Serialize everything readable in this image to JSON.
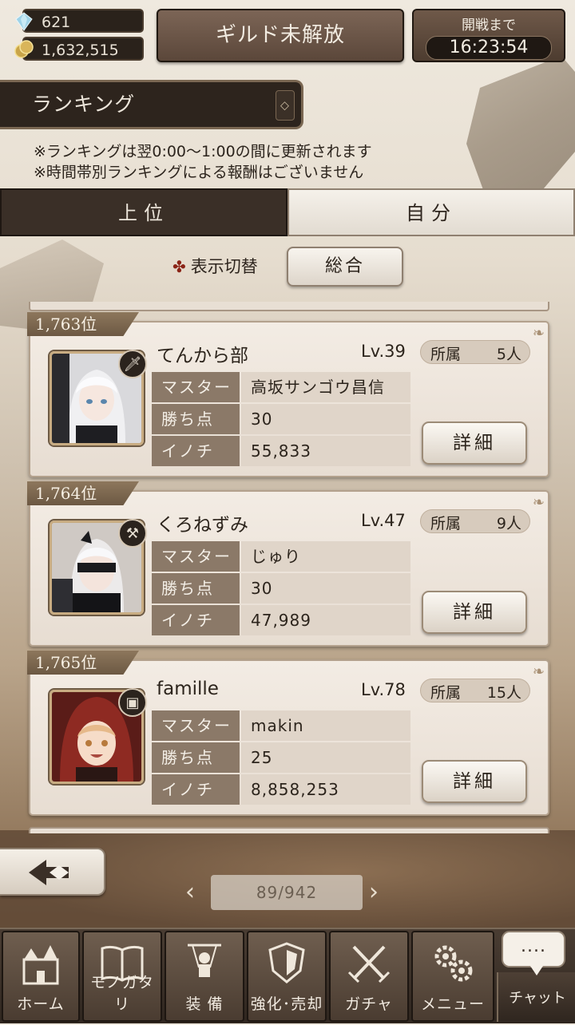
{
  "currency": {
    "gems": "621",
    "gold": "1,632,515"
  },
  "guild_button": "ギルド未解放",
  "battle": {
    "label": "開戦まで",
    "time": "16:23:54"
  },
  "ranking_header": "ランキング",
  "notices": [
    "※ランキングは翌0:00〜1:00の間に更新されます",
    "※時間帯別ランキングによる報酬はございません"
  ],
  "tabs": {
    "top": "上位",
    "self": "自分"
  },
  "display_switch": {
    "label": "表示切替",
    "value": "総合"
  },
  "stat_labels": {
    "master": "マスター",
    "win_points": "勝ち点",
    "life": "イノチ"
  },
  "affiliation_label": "所属",
  "detail_label": "詳細",
  "entries": [
    {
      "rank": "1,763位",
      "name": "てんから部",
      "level": "Lv.39",
      "members": "5人",
      "master": "高坂サンゴウ昌信",
      "win_points": "30",
      "life": "55,833"
    },
    {
      "rank": "1,764位",
      "name": "くろねずみ",
      "level": "Lv.47",
      "members": "9人",
      "master": "じゅり",
      "win_points": "30",
      "life": "47,989"
    },
    {
      "rank": "1,765位",
      "name": "famille",
      "level": "Lv.78",
      "members": "15人",
      "master": "makin",
      "win_points": "25",
      "life": "8,858,253"
    }
  ],
  "pagination": {
    "text": "89/942"
  },
  "nav": {
    "home": "ホーム",
    "story": "モノガタリ",
    "equip": "装 備",
    "enhance": "強化･売却",
    "gacha": "ガチャ",
    "menu": "メニュー",
    "chat": "チャット",
    "chat_bubble": "...."
  }
}
